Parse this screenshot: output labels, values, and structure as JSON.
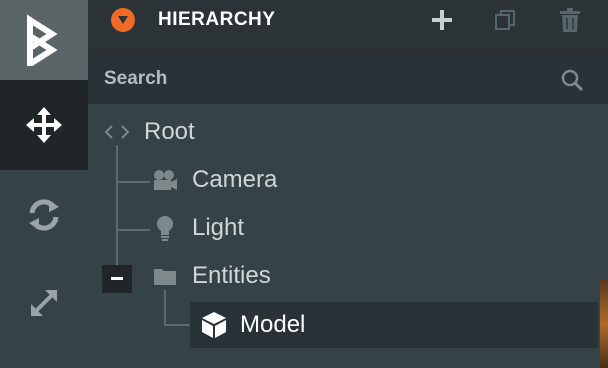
{
  "toolbar": {
    "logo_icon": "playcanvas-logo-icon",
    "tools": [
      {
        "id": "move",
        "icon": "translate-arrows-icon",
        "active": true
      },
      {
        "id": "rotate",
        "icon": "rotate-arrows-icon",
        "active": false
      },
      {
        "id": "scale",
        "icon": "scale-diagonal-arrows-icon",
        "active": false
      }
    ]
  },
  "hierarchy": {
    "title": "HIERARCHY",
    "accent_color": "#f06a26",
    "actions": [
      "add-icon",
      "duplicate-icon",
      "delete-icon"
    ],
    "search": {
      "placeholder": "Search",
      "value": ""
    },
    "tree": {
      "root": {
        "label": "Root",
        "icon": "code-brackets-icon"
      },
      "camera": {
        "label": "Camera",
        "icon": "camera-icon"
      },
      "light": {
        "label": "Light",
        "icon": "lightbulb-icon"
      },
      "entities": {
        "label": "Entities",
        "icon": "folder-icon",
        "expanded": true
      },
      "model": {
        "label": "Model",
        "icon": "cube-icon",
        "selected": true
      }
    }
  }
}
